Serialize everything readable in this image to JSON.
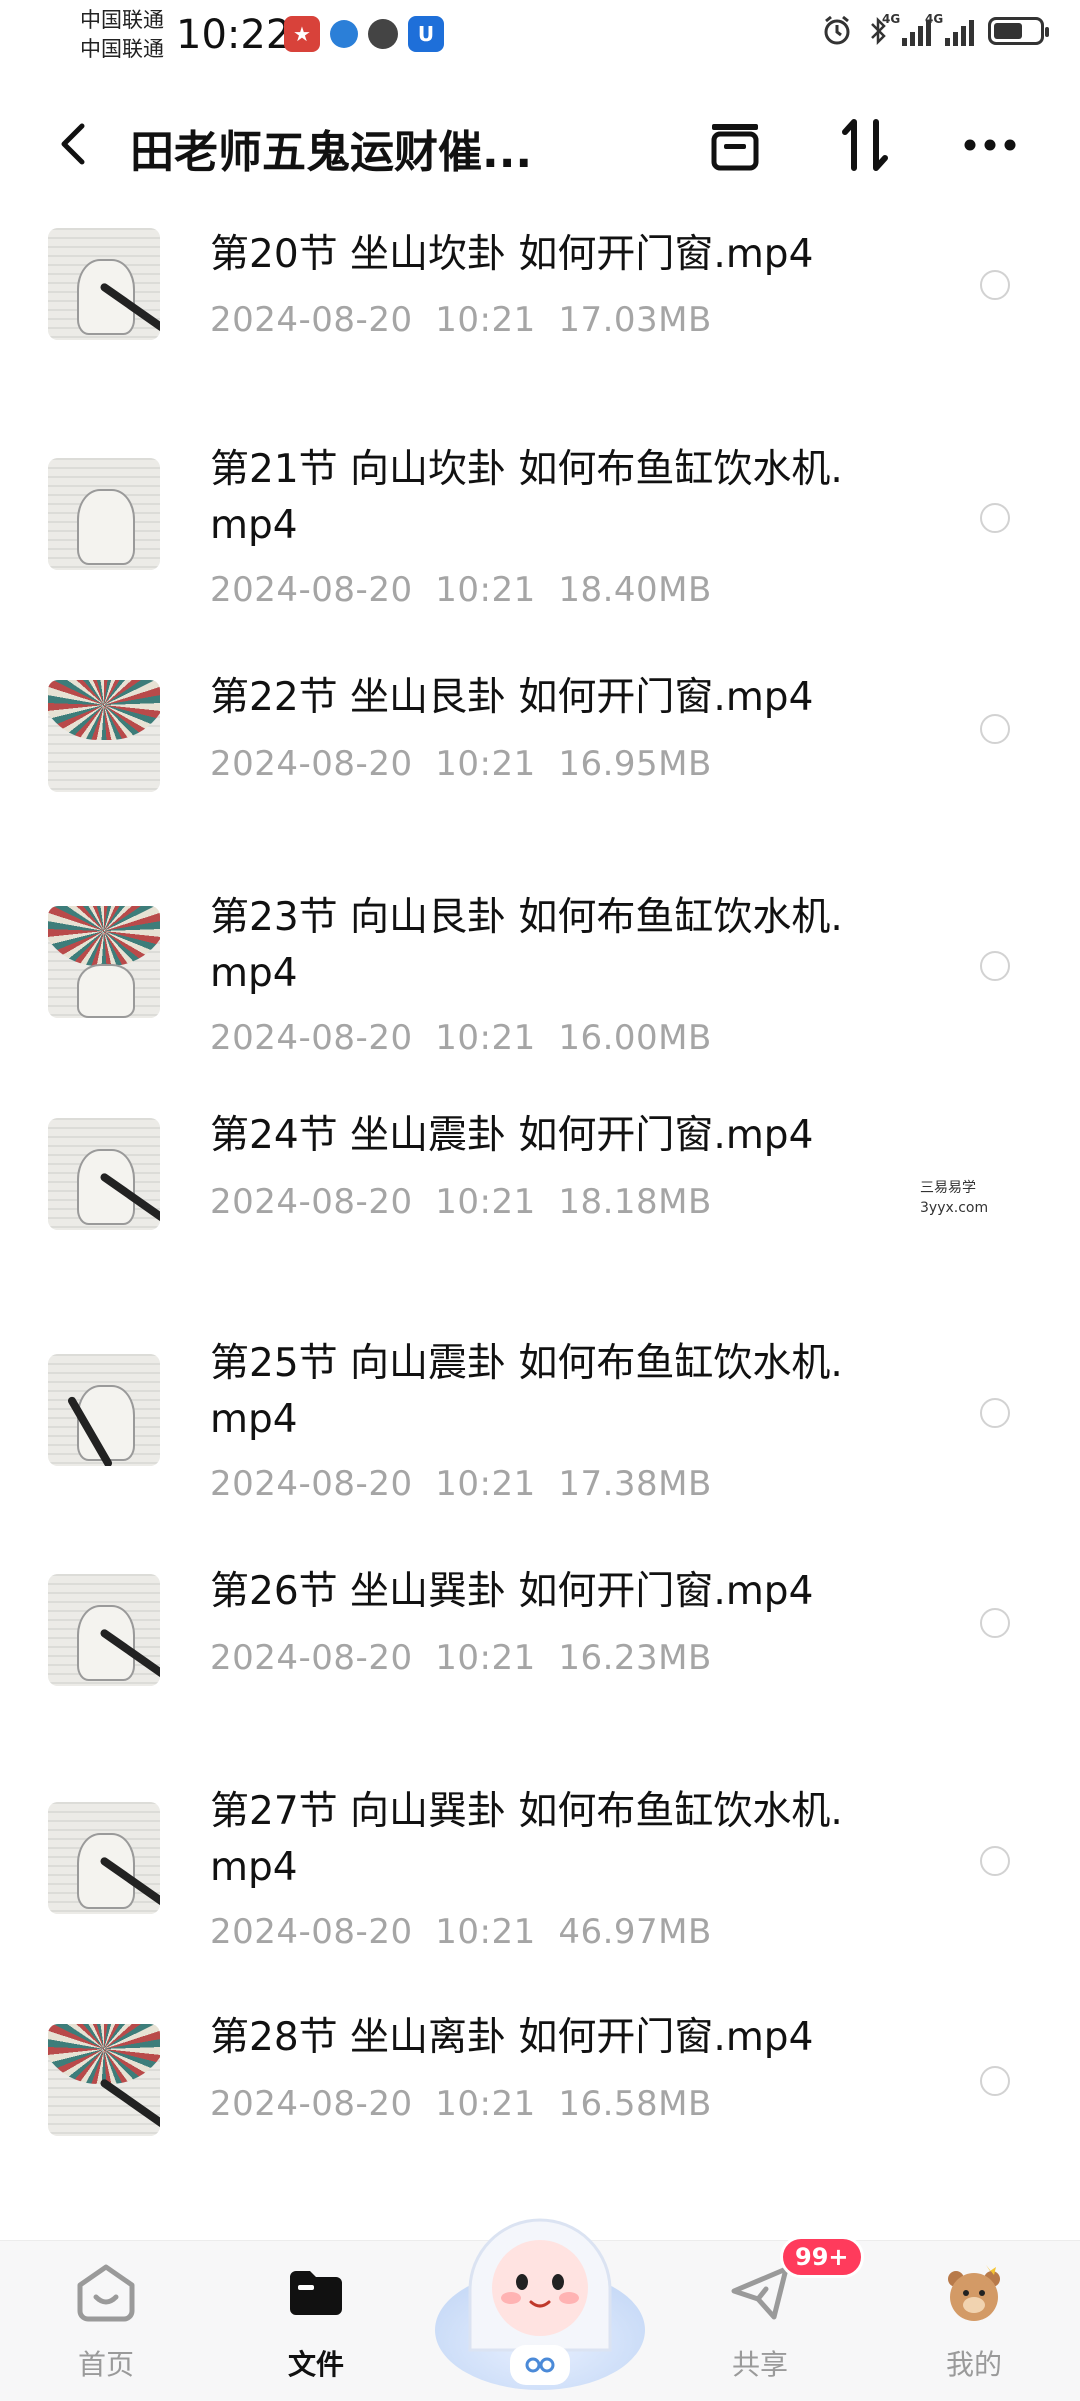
{
  "status_bar": {
    "carrier_1": "中国联通",
    "carrier_2": "中国联通",
    "time": "10:22",
    "network_1": "4G",
    "network_2": "4G"
  },
  "header": {
    "title": "田老师五鬼运财催..."
  },
  "files": [
    {
      "name": "第20节 坐山坎卦 如何开门窗.mp4",
      "date": "2024-08-20",
      "time": "10:21",
      "size": "17.03MB"
    },
    {
      "name": "第21节 向山坎卦 如何布鱼缸饮水机.mp4",
      "date": "2024-08-20",
      "time": "10:21",
      "size": "18.40MB"
    },
    {
      "name": "第22节 坐山艮卦 如何开门窗.mp4",
      "date": "2024-08-20",
      "time": "10:21",
      "size": "16.95MB"
    },
    {
      "name": "第23节 向山艮卦 如何布鱼缸饮水机.mp4",
      "date": "2024-08-20",
      "time": "10:21",
      "size": "16.00MB"
    },
    {
      "name": "第24节 坐山震卦 如何开门窗.mp4",
      "date": "2024-08-20",
      "time": "10:21",
      "size": "18.18MB"
    },
    {
      "name": "第25节 向山震卦 如何布鱼缸饮水机.mp4",
      "date": "2024-08-20",
      "time": "10:21",
      "size": "17.38MB"
    },
    {
      "name": "第26节 坐山巽卦 如何开门窗.mp4",
      "date": "2024-08-20",
      "time": "10:21",
      "size": "16.23MB"
    },
    {
      "name": "第27节 向山巽卦 如何布鱼缸饮水机.mp4",
      "date": "2024-08-20",
      "time": "10:21",
      "size": "46.97MB"
    },
    {
      "name": "第28节 坐山离卦 如何开门窗.mp4",
      "date": "2024-08-20",
      "time": "10:21",
      "size": "16.58MB"
    }
  ],
  "watermark": {
    "line1": "三易易学",
    "line2": "3yyx.com"
  },
  "bottom_nav": {
    "home": "首页",
    "files": "文件",
    "share": "共享",
    "mine": "我的",
    "share_badge": "99+"
  }
}
